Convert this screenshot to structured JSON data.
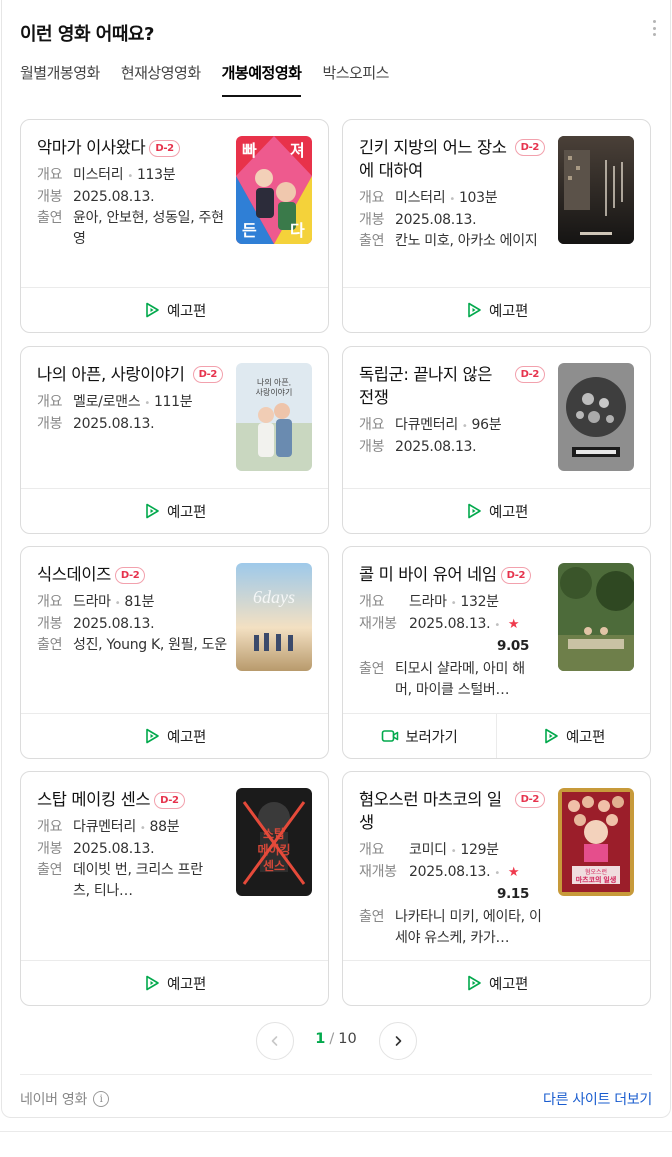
{
  "header": {
    "title": "이런 영화 어때요?"
  },
  "tabs": [
    {
      "label": "월별개봉영화",
      "active": false
    },
    {
      "label": "현재상영영화",
      "active": false
    },
    {
      "label": "개봉예정영화",
      "active": true
    },
    {
      "label": "박스오피스",
      "active": false
    }
  ],
  "labels": {
    "genre": "개요",
    "release": "개봉",
    "rerelease": "재개봉",
    "cast": "출연",
    "trailer": "예고편",
    "watch": "보러가기"
  },
  "movies": [
    {
      "title": "악마가 이사왔다",
      "badge": "D-2",
      "genre": "미스터리",
      "runtime": "113분",
      "date": "2025.08.13.",
      "cast": "윤아, 안보현, 성동일, 주현영"
    },
    {
      "title": "긴키 지방의 어느 장소에 대하여",
      "badge": "D-2",
      "genre": "미스터리",
      "runtime": "103분",
      "date": "2025.08.13.",
      "cast": "칸노 미호, 아카소 에이지"
    },
    {
      "title": "나의 아픈, 사랑이야기",
      "badge": "D-2",
      "genre": "멜로/로맨스",
      "runtime": "111분",
      "date": "2025.08.13."
    },
    {
      "title": "독립군: 끝나지 않은 전쟁",
      "badge": "D-2",
      "genre": "다큐멘터리",
      "runtime": "96분",
      "date": "2025.08.13."
    },
    {
      "title": "식스데이즈",
      "badge": "D-2",
      "genre": "드라마",
      "runtime": "81분",
      "date": "2025.08.13.",
      "cast": "성진, Young K, 원필, 도운"
    },
    {
      "title": "콜 미 바이 유어 네임",
      "badge": "D-2",
      "genre": "드라마",
      "runtime": "132분",
      "date": "2025.08.13.",
      "star": "★",
      "score": "9.05",
      "cast": "티모시 샬라메, 아미 해머, 마이클 스털버…"
    },
    {
      "title": "스탑 메이킹 센스",
      "badge": "D-2",
      "genre": "다큐멘터리",
      "runtime": "88분",
      "date": "2025.08.13.",
      "cast": "데이빗 번, 크리스 프란츠, 티나…"
    },
    {
      "title": "혐오스런 마츠코의 일생",
      "badge": "D-2",
      "genre": "코미디",
      "runtime": "129분",
      "date": "2025.08.13.",
      "star": "★",
      "score": "9.15",
      "cast": "나카타니 미키, 에이타, 이세야 유스케, 카가…"
    }
  ],
  "pagination": {
    "current": "1",
    "separator": "/",
    "total": "10"
  },
  "footer": {
    "source": "네이버 영화",
    "info_icon": "i",
    "more_link": "다른 사이트 더보기"
  },
  "icons": {
    "trailer": "play-icon",
    "watch": "video-camera-icon"
  },
  "colors": {
    "accent_green": "#03a94d",
    "badge_red": "#e6334d",
    "link_blue": "#1a5dcf"
  }
}
